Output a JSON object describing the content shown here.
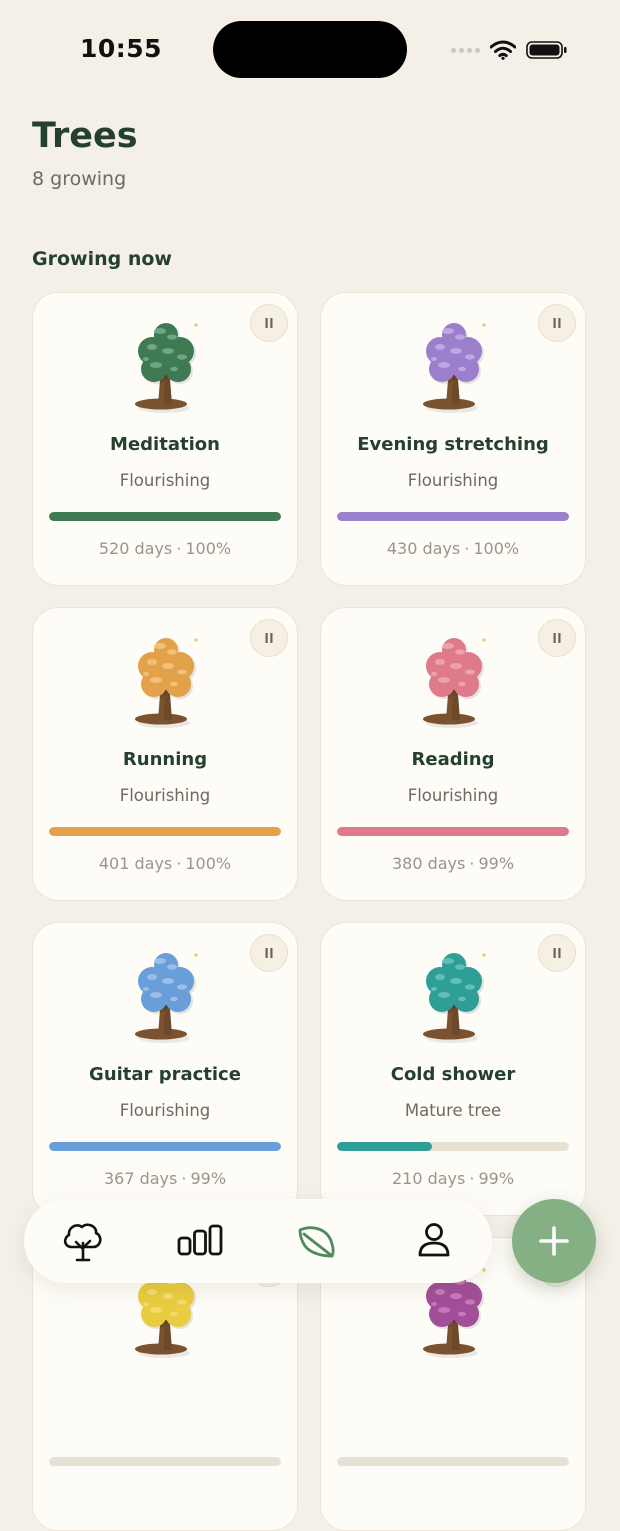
{
  "status_bar": {
    "time": "10:55"
  },
  "header": {
    "title": "Trees",
    "subtitle": "8 growing"
  },
  "section": {
    "heading": "Growing now"
  },
  "cards": [
    {
      "name": "Meditation",
      "status": "Flourishing",
      "days": "520 days",
      "percent": "100%",
      "progress": 1.0,
      "color": "#3f7a55",
      "light": "#7fb597"
    },
    {
      "name": "Evening stretching",
      "status": "Flourishing",
      "days": "430 days",
      "percent": "100%",
      "progress": 1.0,
      "color": "#9c7fcc",
      "light": "#c8b3ec"
    },
    {
      "name": "Running",
      "status": "Flourishing",
      "days": "401 days",
      "percent": "100%",
      "progress": 1.0,
      "color": "#e3a24a",
      "light": "#f5cb8a"
    },
    {
      "name": "Reading",
      "status": "Flourishing",
      "days": "380 days",
      "percent": "99%",
      "progress": 1.0,
      "color": "#df7a8a",
      "light": "#f2b0ba"
    },
    {
      "name": "Guitar practice",
      "status": "Flourishing",
      "days": "367 days",
      "percent": "99%",
      "progress": 1.0,
      "color": "#6a9ed8",
      "light": "#a9c9ee"
    },
    {
      "name": "Cold shower",
      "status": "Mature tree",
      "days": "210 days",
      "percent": "99%",
      "progress": 0.41,
      "color": "#2f9e97",
      "light": "#73c9c3"
    },
    {
      "name": "",
      "status": "",
      "days": "",
      "percent": "",
      "progress": 0,
      "color": "#e9cc3f",
      "light": "#f5e27d"
    },
    {
      "name": "",
      "status": "",
      "days": "",
      "percent": "",
      "progress": 0,
      "color": "#a24e98",
      "light": "#cf8ac6"
    }
  ],
  "tab_bar": {
    "items": [
      {
        "icon": "tree-icon"
      },
      {
        "icon": "stats-icon"
      },
      {
        "icon": "leaf-icon",
        "active": true
      },
      {
        "icon": "profile-icon"
      }
    ],
    "active_color": "#4f8a5c"
  },
  "fab": {
    "icon": "plus-icon",
    "color": "#85b084"
  }
}
